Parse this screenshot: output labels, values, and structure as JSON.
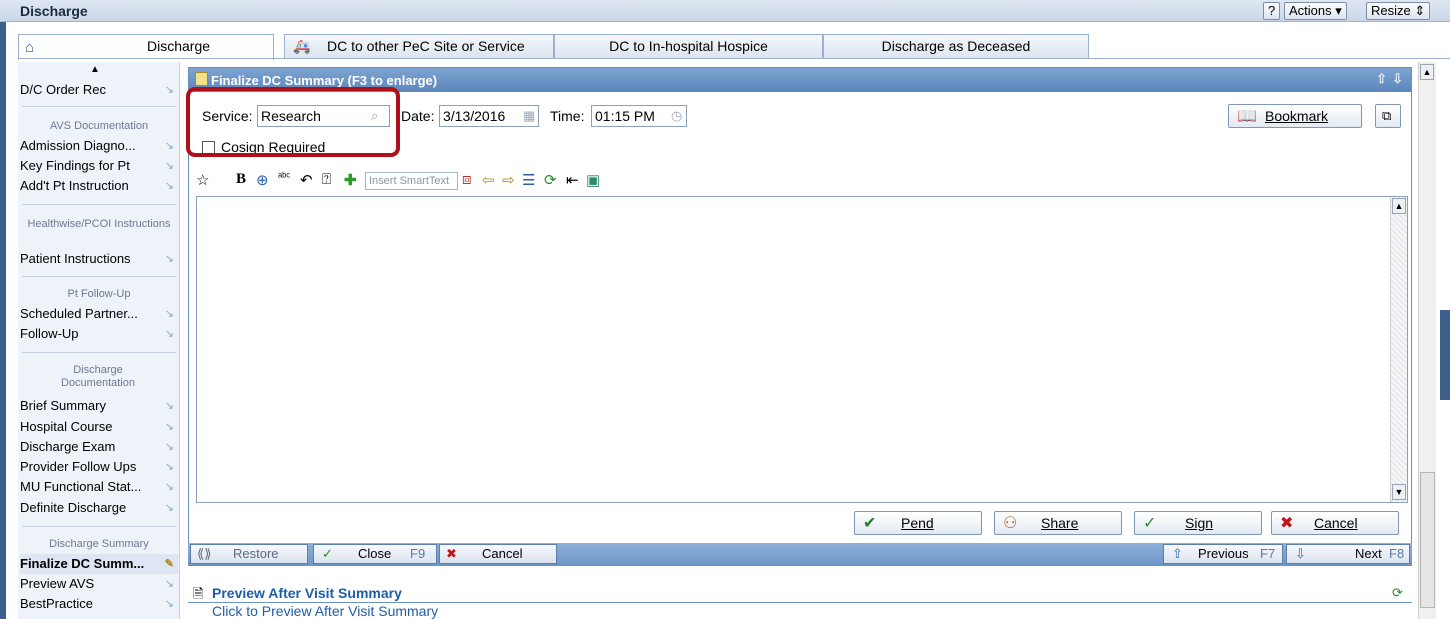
{
  "window": {
    "title": "Discharge",
    "help_label": "?",
    "actions_label": "Actions ▾",
    "resize_label": "Resize ⇕"
  },
  "tabs": [
    {
      "label": "Discharge"
    },
    {
      "label": "DC to other PeC Site or Service"
    },
    {
      "label": "DC to In-hospital Hospice"
    },
    {
      "label": "Discharge as Deceased"
    }
  ],
  "sidebar": {
    "items": [
      {
        "label": "D/C Order Rec"
      },
      {
        "label": "Admission Diagno..."
      },
      {
        "label": "Key Findings for Pt"
      },
      {
        "label": "Add't Pt Instruction"
      },
      {
        "label": "Patient Instructions"
      },
      {
        "label": "Scheduled Partner..."
      },
      {
        "label": "Follow-Up"
      },
      {
        "label": "Brief Summary"
      },
      {
        "label": "Hospital Course"
      },
      {
        "label": "Discharge Exam"
      },
      {
        "label": "Provider Follow Ups"
      },
      {
        "label": "MU Functional Stat..."
      },
      {
        "label": "Definite Discharge"
      },
      {
        "label": "Finalize DC Summ..."
      },
      {
        "label": "Preview AVS"
      },
      {
        "label": "BestPractice"
      }
    ],
    "sections": [
      {
        "label": "AVS Documentation"
      },
      {
        "label": "Healthwise/PCOI Instructions"
      },
      {
        "label": "Pt Follow-Up"
      },
      {
        "label": "Discharge Documentation"
      },
      {
        "label": "Discharge Summary"
      }
    ]
  },
  "panel": {
    "title": "Finalize DC Summary (F3 to enlarge)",
    "service_label": "Service:",
    "service_value": "Research",
    "date_label": "Date:",
    "date_value": "3/13/2016",
    "time_label": "Time:",
    "time_value": "01:15 PM",
    "cosign_label": "Cosign Required",
    "bookmark_label": "Bookmark",
    "smarttext_placeholder": "Insert SmartText"
  },
  "actions": {
    "pend": "Pend",
    "share": "Share",
    "sign": "Sign",
    "cancel": "Cancel"
  },
  "footer": {
    "restore": "Restore",
    "close": "Close",
    "close_key": "F9",
    "cancel": "Cancel",
    "previous": "Previous",
    "previous_key": "F7",
    "next": "Next",
    "next_key": "F8"
  },
  "preview": {
    "title": "Preview After Visit Summary",
    "link": "Click to Preview After Visit Summary"
  },
  "colors": {
    "highlight": "#b0101a",
    "header_blue": "#5b86bd",
    "link_blue": "#1e5ea8"
  }
}
